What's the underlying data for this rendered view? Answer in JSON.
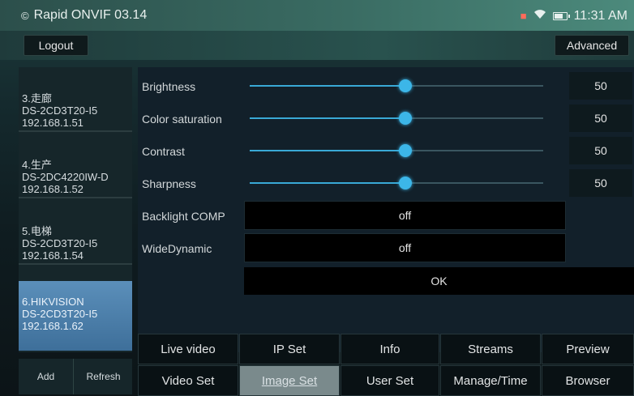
{
  "status_bar": {
    "app_title": "Rapid ONVIF 03.14",
    "time": "11:31 AM"
  },
  "toolbar": {
    "logout_label": "Logout",
    "advanced_label": "Advanced"
  },
  "cameras": [
    {
      "name": "3.走廊",
      "model": "DS-2CD3T20-I5",
      "ip": "192.168.1.51",
      "selected": false
    },
    {
      "name": "4.生产",
      "model": "DS-2DC4220IW-D",
      "ip": "192.168.1.52",
      "selected": false
    },
    {
      "name": "5.电梯",
      "model": "DS-2CD3T20-I5",
      "ip": "192.168.1.54",
      "selected": false
    },
    {
      "name": "6.HIKVISION",
      "model": "DS-2CD3T20-I5",
      "ip": "192.168.1.62",
      "selected": true
    }
  ],
  "list_buttons": {
    "add_label": "Add",
    "refresh_label": "Refresh"
  },
  "image_settings": {
    "sliders": [
      {
        "label": "Brightness",
        "value": "50",
        "fraction": 0.53
      },
      {
        "label": "Color saturation",
        "value": "50",
        "fraction": 0.53
      },
      {
        "label": "Contrast",
        "value": "50",
        "fraction": 0.53
      },
      {
        "label": "Sharpness",
        "value": "50",
        "fraction": 0.53
      }
    ],
    "backlight_label": "Backlight COMP",
    "backlight_value": "off",
    "widedynamic_label": "WideDynamic",
    "widedynamic_value": "off",
    "ok_label": "OK"
  },
  "tabs_row1": [
    "Live video",
    "IP Set",
    "Info",
    "Streams",
    "Preview"
  ],
  "tabs_row2": [
    "Video Set",
    "Image Set",
    "User Set",
    "Manage/Time",
    "Browser"
  ],
  "active_tab": "Image Set",
  "colors": {
    "accent": "#3cb6e8",
    "selected_camera": "#4f82ad",
    "active_tab": "#7a8a8c"
  }
}
